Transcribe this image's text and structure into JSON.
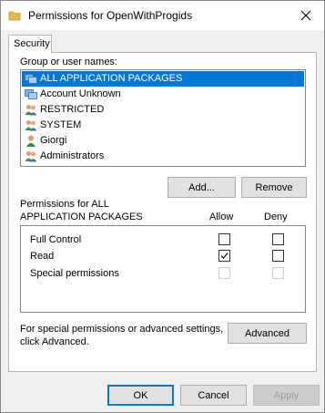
{
  "window": {
    "title": "Permissions for OpenWithProgids"
  },
  "tabs": [
    {
      "label": "Security"
    }
  ],
  "group_section": {
    "label": "Group or user names:",
    "users": [
      {
        "name": "ALL APPLICATION PACKAGES",
        "icon": "app-packages-icon",
        "selected": true
      },
      {
        "name": "Account Unknown",
        "icon": "app-packages-icon",
        "selected": false
      },
      {
        "name": "RESTRICTED",
        "icon": "user-group-icon",
        "selected": false
      },
      {
        "name": "SYSTEM",
        "icon": "user-group-icon",
        "selected": false
      },
      {
        "name": "Giorgi",
        "icon": "user-icon",
        "selected": false
      },
      {
        "name": "Administrators",
        "icon": "user-group-icon",
        "selected": false
      }
    ],
    "add_label": "Add...",
    "remove_label": "Remove"
  },
  "permissions_section": {
    "label_line1": "Permissions for ALL",
    "label_line2": "APPLICATION PACKAGES",
    "allow_header": "Allow",
    "deny_header": "Deny",
    "rows": [
      {
        "name": "Full Control",
        "allow": false,
        "deny": false,
        "disabled": false
      },
      {
        "name": "Read",
        "allow": true,
        "deny": false,
        "disabled": false
      },
      {
        "name": "Special permissions",
        "allow": false,
        "deny": false,
        "disabled": true
      }
    ]
  },
  "advanced_section": {
    "text_line1": "For special permissions or advanced settings,",
    "text_line2": "click Advanced.",
    "button_label": "Advanced"
  },
  "footer": {
    "ok_label": "OK",
    "cancel_label": "Cancel",
    "apply_label": "Apply"
  },
  "colors": {
    "selection": "#0078d7",
    "dialog_bg": "#f0f0f0",
    "folder": "#e8b84a"
  }
}
